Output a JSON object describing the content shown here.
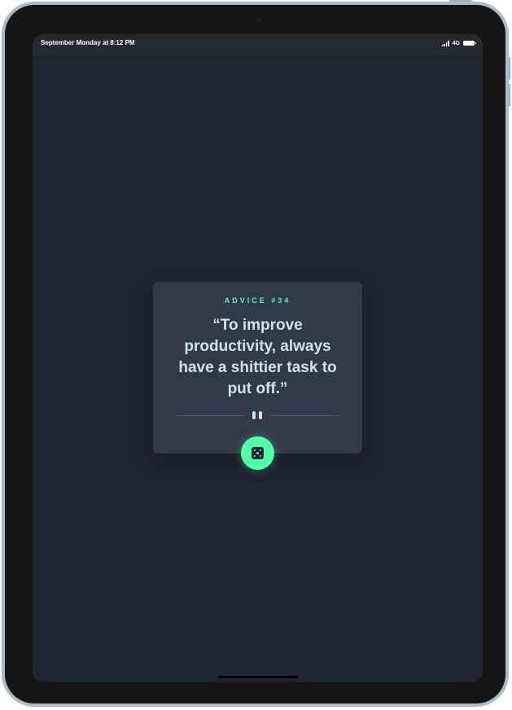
{
  "status_bar": {
    "time_text": "September Monday at 8:12 PM",
    "network": "4G"
  },
  "advice_card": {
    "label": "ADVICE #34",
    "quote": "“To improve productivity, always have a shittier task to put off.”"
  },
  "icons": {
    "signal": "cellular-signal-icon",
    "battery": "battery-icon",
    "divider": "pause-icon",
    "dice": "dice-icon"
  },
  "colors": {
    "background": "#1f2531",
    "card": "#313a49",
    "accent": "#52ffa8",
    "quote_text": "#cee3e9",
    "divider": "#4f5d74"
  }
}
